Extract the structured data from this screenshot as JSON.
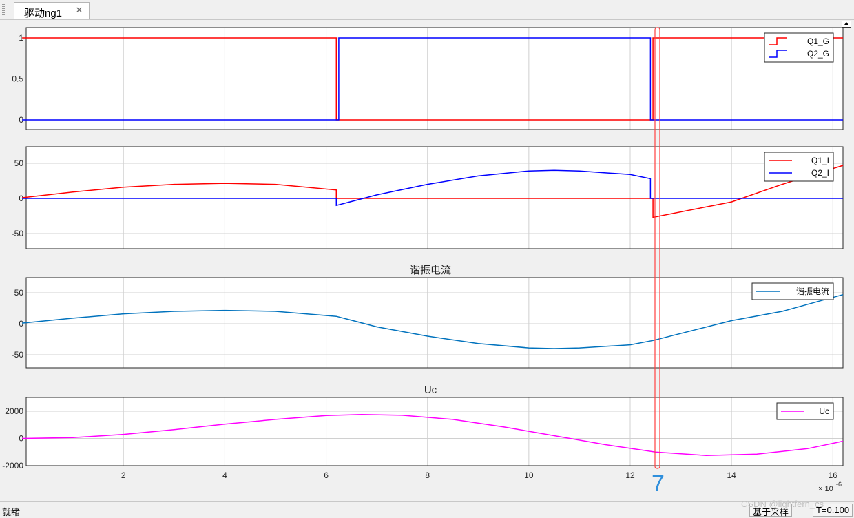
{
  "tab": {
    "title": "驱动ng1",
    "close_glyph": "✕"
  },
  "status": {
    "left": "就绪",
    "sampling": "基于采样",
    "time": "T=0.100",
    "watermark": "CSDN @lightfern_cs"
  },
  "marker_label": "7",
  "x_exponent": "× 10",
  "x_exponent_power": "-6",
  "x_ticks": [
    "2",
    "4",
    "6",
    "8",
    "10",
    "12",
    "14",
    "16"
  ],
  "chart_data": [
    {
      "type": "line",
      "title": "",
      "xlim": [
        0,
        16.2
      ],
      "ylim": [
        -0.1,
        1.15
      ],
      "yticks": [
        "1",
        "0.5",
        "0"
      ],
      "legend_position": "top-right",
      "series": [
        {
          "name": "Q1_G",
          "color": "#ff0000",
          "step": true,
          "x": [
            0,
            6.2,
            6.2,
            12.45,
            12.45,
            16.2
          ],
          "y": [
            1,
            1,
            0,
            0,
            1,
            1
          ]
        },
        {
          "name": "Q2_G",
          "color": "#0000ff",
          "step": true,
          "x": [
            0,
            6.25,
            6.25,
            12.4,
            12.4,
            16.2
          ],
          "y": [
            0,
            0,
            1,
            1,
            0,
            0
          ]
        }
      ]
    },
    {
      "type": "line",
      "title": "",
      "xlim": [
        0,
        16.2
      ],
      "ylim": [
        -72,
        72
      ],
      "yticks": [
        "50",
        "0",
        "-50"
      ],
      "legend_position": "top-right",
      "series": [
        {
          "name": "Q1_I",
          "color": "#ff0000",
          "x": [
            0,
            1,
            2,
            3,
            4,
            5,
            6.2,
            6.2,
            12.45,
            12.45,
            14,
            15,
            16.2
          ],
          "y": [
            1,
            9,
            16,
            20,
            21.5,
            20,
            12,
            0,
            0,
            -27,
            -5,
            20,
            47
          ]
        },
        {
          "name": "Q2_I",
          "color": "#0000ff",
          "x": [
            0,
            6.2,
            6.2,
            7,
            8,
            9,
            10,
            10.5,
            11,
            12,
            12.4,
            12.4,
            16.2
          ],
          "y": [
            0,
            0,
            -10,
            5,
            20,
            32,
            39,
            40,
            39,
            34,
            28,
            0,
            0
          ]
        }
      ]
    },
    {
      "type": "line",
      "title": "谐振电流",
      "xlim": [
        0,
        16.2
      ],
      "ylim": [
        -72,
        72
      ],
      "yticks": [
        "50",
        "0",
        "-50"
      ],
      "legend_position": "top-right",
      "series": [
        {
          "name": "谐振电流",
          "color": "#0072bd",
          "x": [
            0,
            1,
            2,
            3,
            4,
            5,
            6.2,
            7,
            8,
            9,
            10,
            10.5,
            11,
            12,
            12.45,
            14,
            15,
            16.2
          ],
          "y": [
            1,
            9,
            16,
            20,
            21.5,
            20,
            12,
            -5,
            -20,
            -32,
            -39,
            -40,
            -39,
            -34,
            -27,
            5,
            20,
            47
          ]
        }
      ]
    },
    {
      "type": "line",
      "title": "Uc",
      "xlim": [
        0,
        16.2
      ],
      "ylim": [
        -2000,
        2000
      ],
      "yticks": [
        "2000",
        "0",
        "-2000"
      ],
      "legend_position": "top-right",
      "series": [
        {
          "name": "Uc",
          "color": "#ff00ff",
          "x": [
            0,
            1,
            2,
            3,
            4,
            5,
            6,
            6.7,
            7.5,
            8.5,
            9.5,
            10.5,
            11.5,
            12.5,
            13.5,
            14.5,
            15.5,
            16.2
          ],
          "y": [
            0,
            60,
            300,
            650,
            1050,
            1400,
            1680,
            1760,
            1700,
            1400,
            850,
            200,
            -450,
            -1000,
            -1250,
            -1150,
            -750,
            -200
          ]
        }
      ]
    }
  ]
}
